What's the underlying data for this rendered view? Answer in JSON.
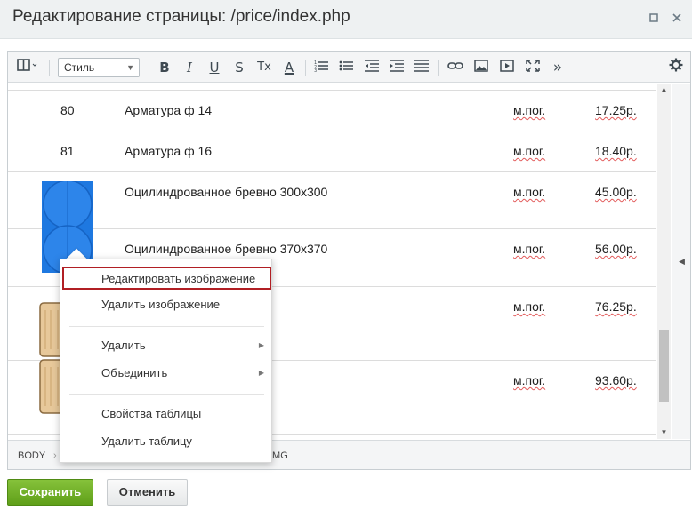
{
  "window": {
    "title": "Редактирование страницы: /price/index.php",
    "maximize_icon": "maximize-icon",
    "close_icon": "close-icon"
  },
  "toolbar": {
    "style_select_value": "Стиль",
    "buttons": [
      {
        "name": "view-mode-button",
        "icon": "columns-icon"
      },
      {
        "name": "bold-button",
        "label": "B"
      },
      {
        "name": "italic-button",
        "label": "I"
      },
      {
        "name": "underline-button",
        "label": "U"
      },
      {
        "name": "strikethrough-button",
        "label": "S"
      },
      {
        "name": "remove-format-button",
        "label": "Tx"
      },
      {
        "name": "font-color-button",
        "label": "A"
      },
      {
        "name": "ordered-list-button",
        "icon": "ordered-list-icon"
      },
      {
        "name": "unordered-list-button",
        "icon": "unordered-list-icon"
      },
      {
        "name": "outdent-button",
        "icon": "outdent-icon"
      },
      {
        "name": "indent-button",
        "icon": "indent-icon"
      },
      {
        "name": "align-button",
        "icon": "align-justify-icon"
      },
      {
        "name": "link-button",
        "icon": "link-icon"
      },
      {
        "name": "image-button",
        "icon": "image-icon"
      },
      {
        "name": "video-button",
        "icon": "video-icon"
      },
      {
        "name": "fullscreen-button",
        "icon": "fullscreen-icon"
      },
      {
        "name": "more-button",
        "label": "»"
      },
      {
        "name": "settings-button",
        "icon": "gear-icon"
      }
    ]
  },
  "table": {
    "rows": [
      {
        "num": "80",
        "name": "Арматура ф 14",
        "unit": "м.пог.",
        "price": "17.25р."
      },
      {
        "num": "81",
        "name": "Арматура ф 16",
        "unit": "м.пог.",
        "price": "18.40р."
      },
      {
        "num": "",
        "name": "Оцилиндрованное бревно 300x300",
        "unit": "м.пог.",
        "price": "45.00р."
      },
      {
        "num": "",
        "name": "Оцилиндрованное бревно 370x370",
        "unit": "м.пог.",
        "price": "56.00р."
      },
      {
        "num": "",
        "name": "",
        "unit": "м.пог.",
        "price": "76.25р."
      },
      {
        "num": "",
        "name": "",
        "unit": "м.пог.",
        "price": "93.60р."
      }
    ]
  },
  "statusbar": {
    "crumbs": [
      "BODY",
      "IMG"
    ]
  },
  "context_menu": {
    "items": [
      {
        "label": "Редактировать изображение",
        "active": true
      },
      {
        "label": "Удалить изображение"
      },
      {
        "label": "Удалить",
        "submenu": true
      },
      {
        "label": "Объединить",
        "submenu": true
      },
      {
        "label": "Свойства таблицы"
      },
      {
        "label": "Удалить таблицу"
      }
    ]
  },
  "footer": {
    "save_label": "Сохранить",
    "cancel_label": "Отменить"
  },
  "colors": {
    "save_button": "#6aab22",
    "menu_highlight_border": "#b11f24",
    "log_image_blue": "#1e78e0"
  }
}
